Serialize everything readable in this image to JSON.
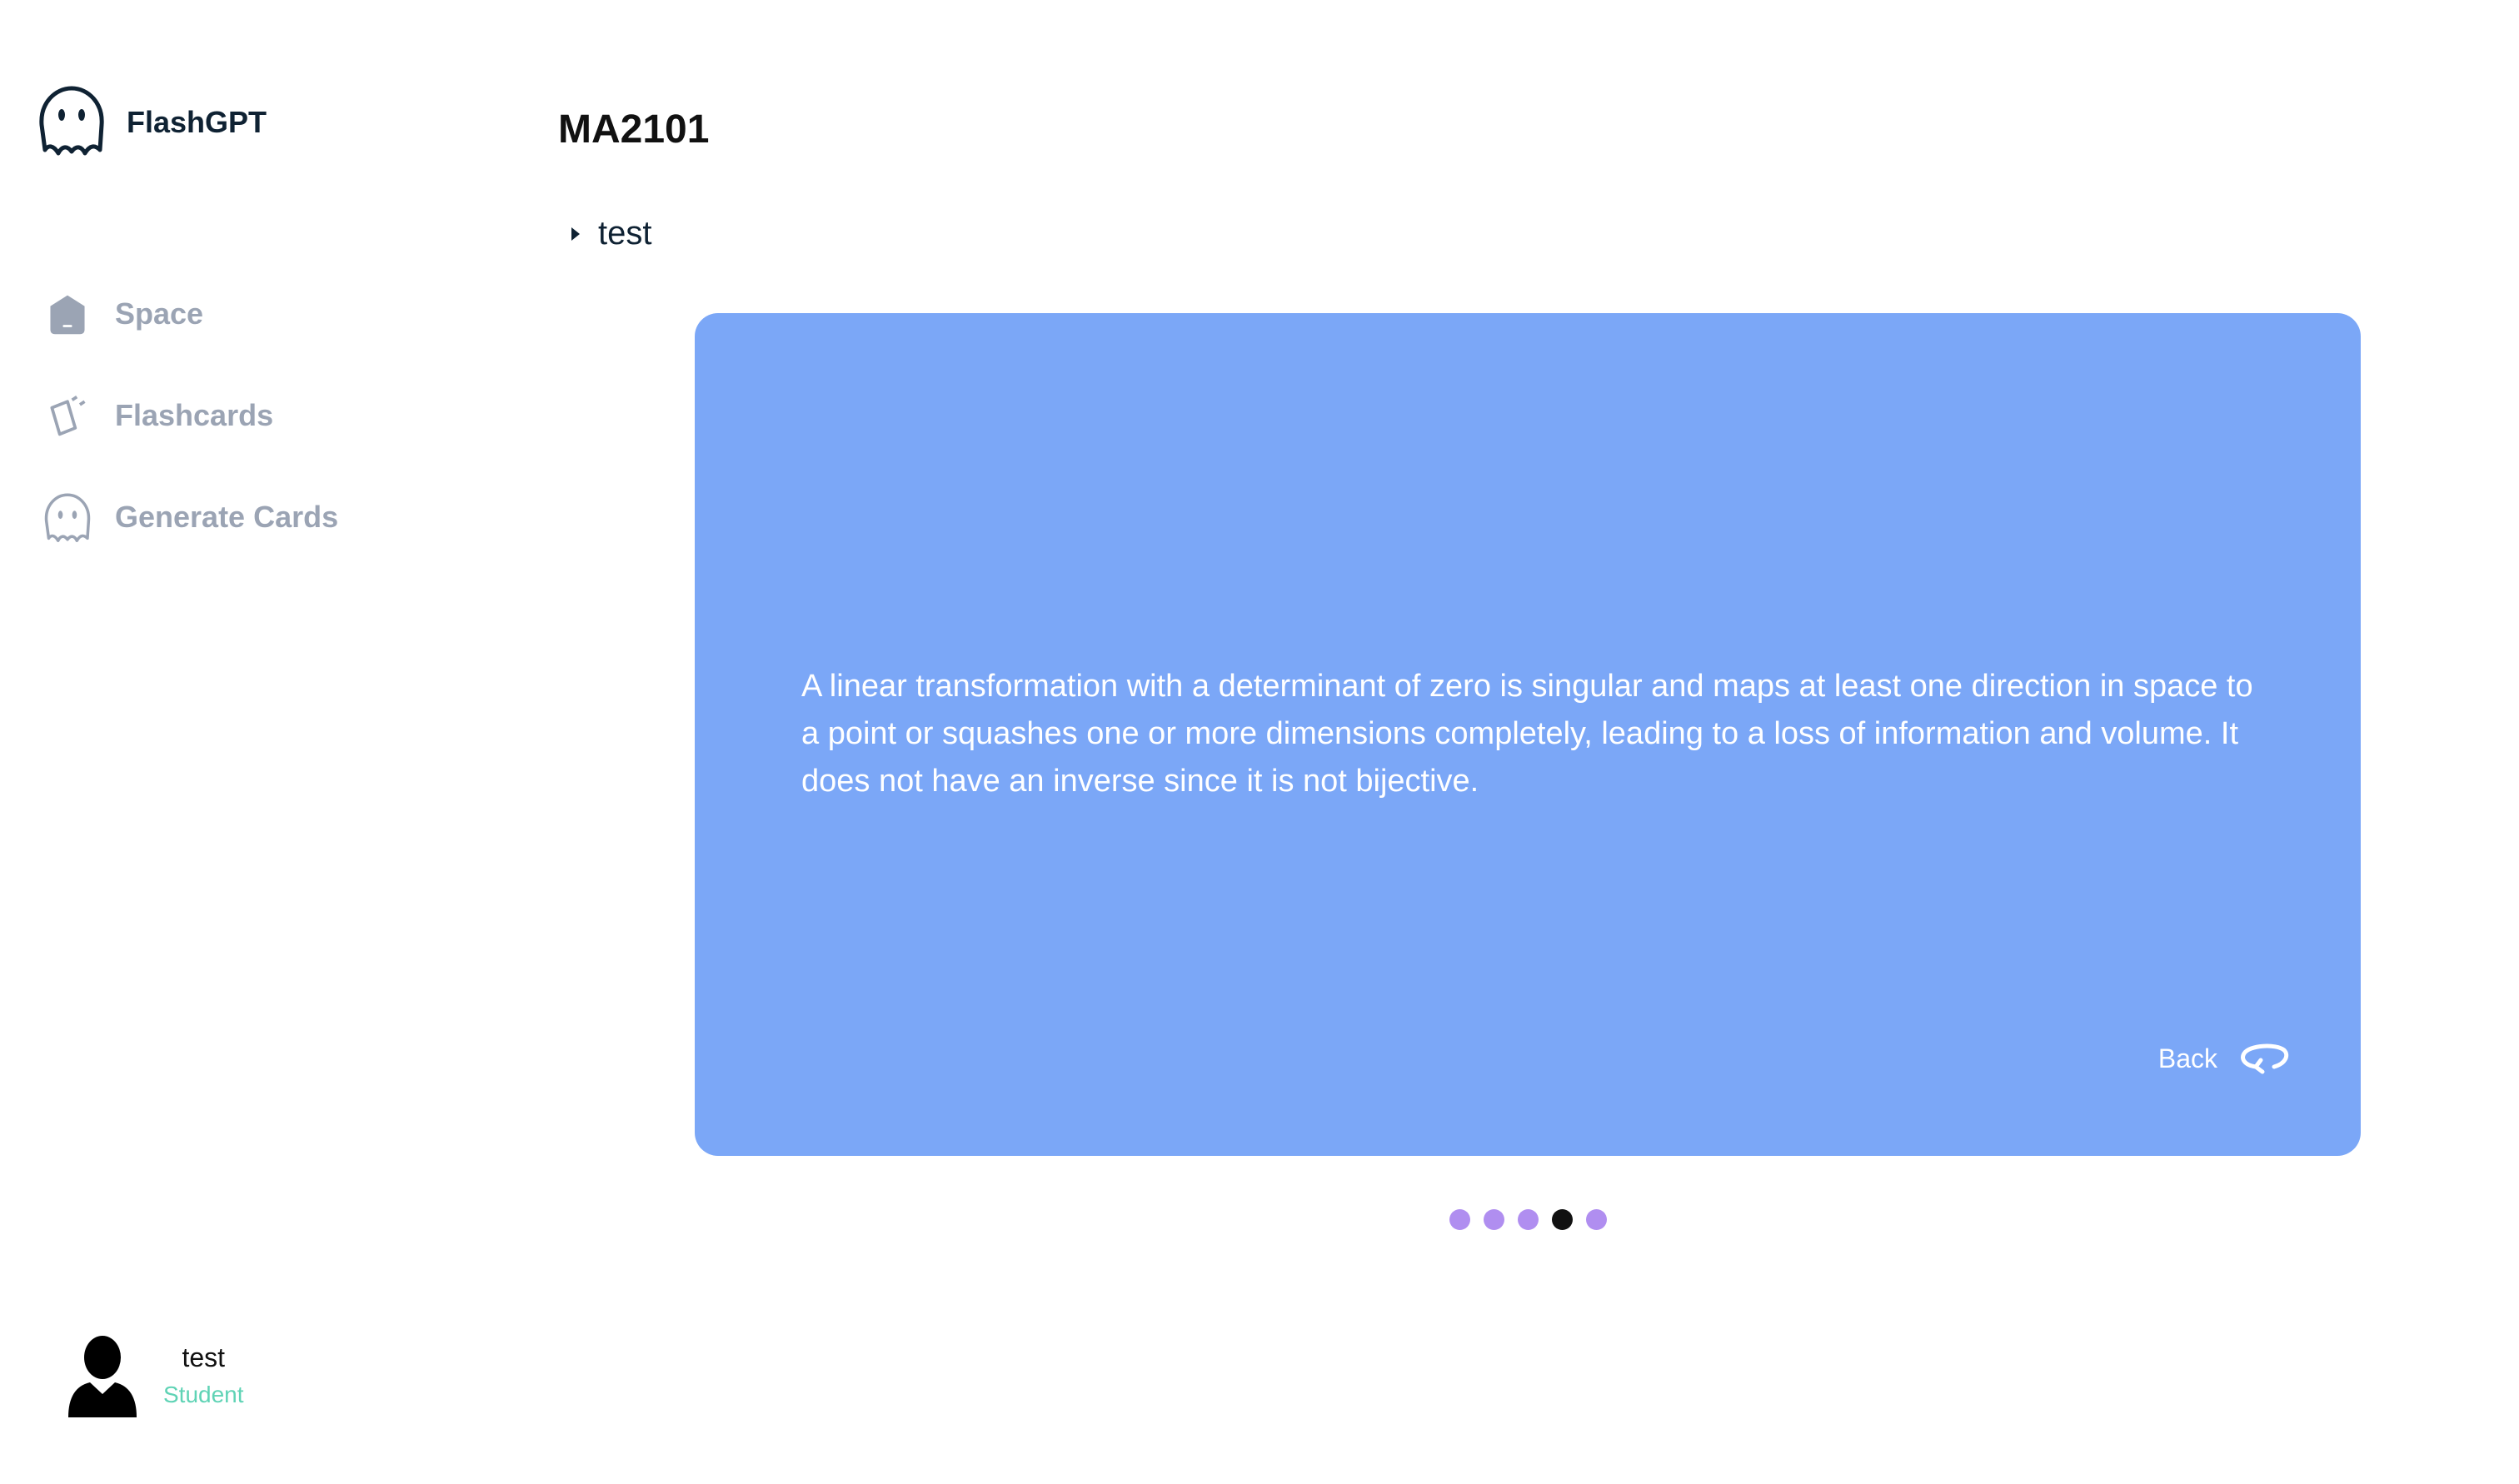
{
  "app": {
    "name": "FlashGPT"
  },
  "sidebar": {
    "items": [
      {
        "label": "Space",
        "icon": "home-icon"
      },
      {
        "label": "Flashcards",
        "icon": "cards-icon"
      },
      {
        "label": "Generate Cards",
        "icon": "ghost-icon"
      }
    ]
  },
  "user": {
    "name": "test",
    "role": "Student"
  },
  "main": {
    "title": "MA2101",
    "deck": {
      "name": "test",
      "expanded": false
    },
    "card": {
      "text": "A linear transformation with a determinant of zero is singular and maps at least one direction in space to a point or squashes one or more dimensions completely, leading to a loss of information and volume. It does not have an inverse since it is not bijective.",
      "flip_label": "Back",
      "color": "#7ba7f7"
    },
    "pagination": {
      "count": 5,
      "active_index": 3
    }
  },
  "colors": {
    "accent": "#7ba7f7",
    "dot": "#b08ef0",
    "dot_active": "#111111",
    "role": "#5fd3b5",
    "nav": "#9ba4b4"
  }
}
